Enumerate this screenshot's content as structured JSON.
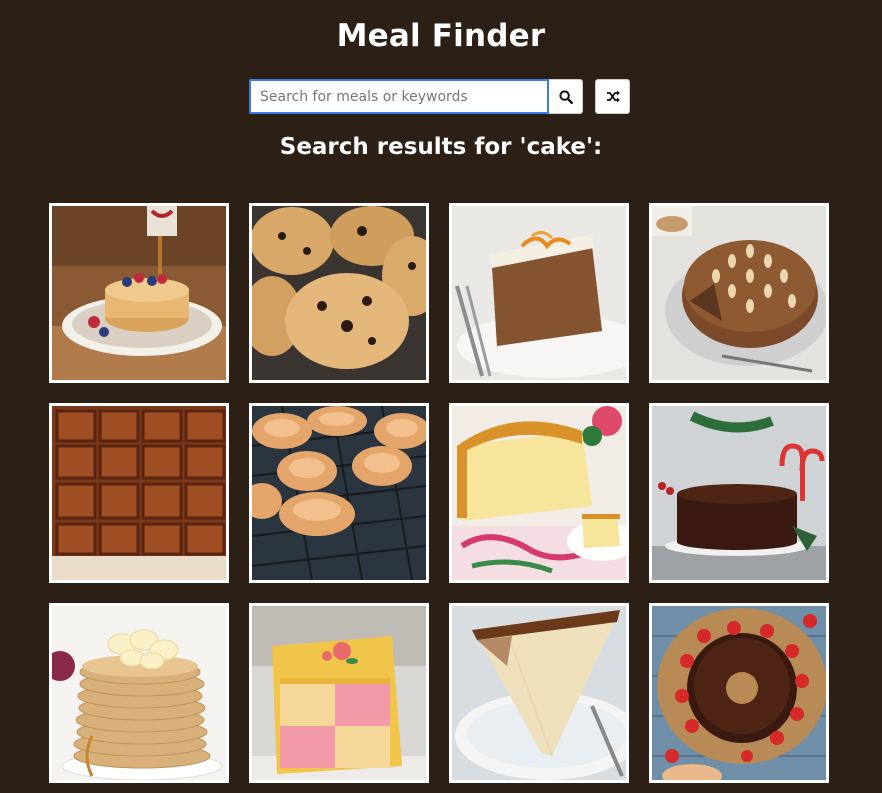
{
  "header": {
    "title": "Meal Finder"
  },
  "search": {
    "placeholder": "Search for meals or keywords",
    "value": ""
  },
  "results": {
    "heading": "Search results for 'cake':"
  },
  "icons": {
    "search": "search-icon",
    "random": "shuffle-icon"
  },
  "colors": {
    "background": "#2b1f16",
    "input_focus": "#3b7be8"
  },
  "meals": [
    {
      "id": "pancakes-berries"
    },
    {
      "id": "rock-cakes"
    },
    {
      "id": "carrot-cake"
    },
    {
      "id": "dundee-cake"
    },
    {
      "id": "parkin"
    },
    {
      "id": "eccles-cakes"
    },
    {
      "id": "madeira-cake"
    },
    {
      "id": "christmas-cake"
    },
    {
      "id": "banana-pancakes"
    },
    {
      "id": "battenberg-cake"
    },
    {
      "id": "cheesecake"
    },
    {
      "id": "chocolate-bundt-cake"
    }
  ]
}
